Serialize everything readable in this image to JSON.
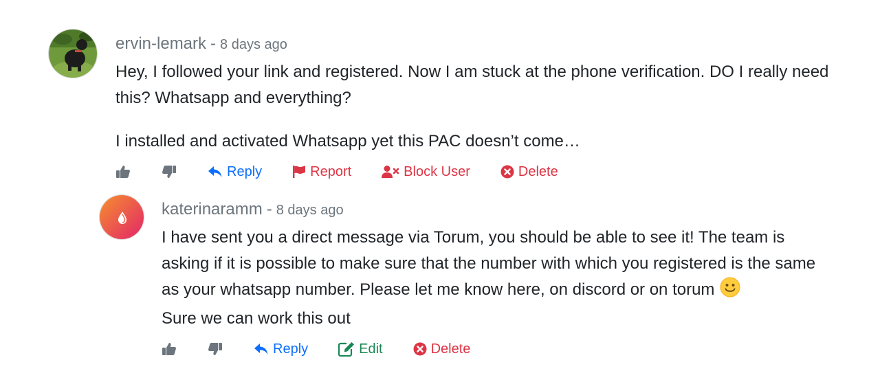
{
  "comments": [
    {
      "author": "ervin-lemark",
      "separator": "-",
      "time": "8 days ago",
      "paragraphs": [
        "Hey, I followed your link and registered. Now I am stuck at the phone verification. DO I really need this? Whatsapp and everything?",
        "I installed and activated Whatsapp yet this PAC doesn’t come…"
      ],
      "actions": {
        "reply": "Reply",
        "report": "Report",
        "block": "Block User",
        "delete": "Delete"
      }
    },
    {
      "author": "katerinaramm",
      "separator": "-",
      "time": "8 days ago",
      "text_line1": "I have sent you a direct message via Torum, you should be able to see it! The team is asking if it is possible to make sure that the number with which you registered is the same as your whatsapp number. Please let me know here, on discord or on torum",
      "text_line2": "Sure we can work this out",
      "actions": {
        "reply": "Reply",
        "edit": "Edit",
        "delete": "Delete"
      }
    }
  ],
  "icons": {
    "like": "thumbs-up-icon",
    "dislike": "thumbs-down-icon",
    "reply": "reply-arrow-icon",
    "report": "flag-icon",
    "block": "user-times-icon",
    "edit": "edit-icon",
    "delete": "times-circle-icon",
    "emoji": "smiley-icon"
  },
  "colors": {
    "muted": "#6c757d",
    "reply": "#0d6efd",
    "danger": "#dc3545",
    "edit": "#198754"
  }
}
